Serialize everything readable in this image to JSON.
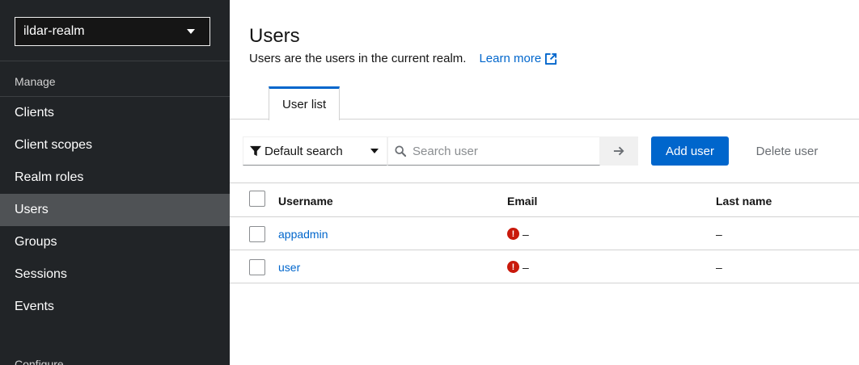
{
  "sidebar": {
    "realm": "ildar-realm",
    "section_manage": "Manage",
    "items": [
      {
        "label": "Clients"
      },
      {
        "label": "Client scopes"
      },
      {
        "label": "Realm roles"
      },
      {
        "label": "Users",
        "active": true
      },
      {
        "label": "Groups"
      },
      {
        "label": "Sessions"
      },
      {
        "label": "Events"
      }
    ],
    "section_configure": "Configure"
  },
  "header": {
    "title": "Users",
    "description": "Users are the users in the current realm.",
    "learn_more": "Learn more"
  },
  "tabs": [
    {
      "label": "User list",
      "active": true
    }
  ],
  "toolbar": {
    "filter_label": "Default search",
    "search_placeholder": "Search user",
    "add_label": "Add user",
    "delete_label": "Delete user"
  },
  "table": {
    "columns": [
      "Username",
      "Email",
      "Last name"
    ],
    "rows": [
      {
        "username": "appadmin",
        "email": "–",
        "last_name": "–"
      },
      {
        "username": "user",
        "email": "–",
        "last_name": "–"
      }
    ]
  },
  "colors": {
    "sidebar_bg": "#212427",
    "active_nav": "#4f5255",
    "primary": "#0066cc",
    "danger": "#c9190b"
  }
}
